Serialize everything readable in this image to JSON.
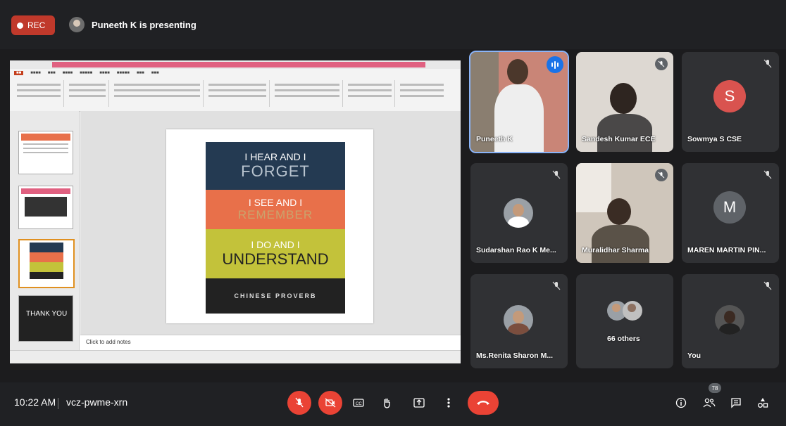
{
  "top_bar": {
    "rec_label": "REC",
    "presenter_text": "Puneeth K is presenting"
  },
  "shared_screen": {
    "slide": {
      "band1_line1": "I HEAR AND I",
      "band1_line2": "FORGET",
      "band2_line1": "I SEE AND I",
      "band2_line2": "REMEMBER",
      "band3_line1": "I DO AND I",
      "band3_line2": "UNDERSTAND",
      "band4_line1": "CHINESE PROVERB"
    },
    "thumbnail_text": "THANK YOU",
    "notes_placeholder": "Click to add notes"
  },
  "participants": [
    {
      "name": "Puneeth K",
      "status": "speaking"
    },
    {
      "name": "Sandesh Kumar ECE",
      "status": "muted"
    },
    {
      "name": "Sowmya S CSE",
      "status": "muted",
      "avatar_letter": "S",
      "avatar_color": "#d9534f"
    },
    {
      "name": "Sudarshan Rao K Me...",
      "status": "muted"
    },
    {
      "name": "Muralidhar Sharma",
      "status": "muted"
    },
    {
      "name": "MAREN MARTIN PIN...",
      "status": "muted",
      "avatar_letter": "M",
      "avatar_color": "#5f6368"
    },
    {
      "name": "Ms.Renita Sharon M...",
      "status": "muted"
    },
    {
      "name": "66 others",
      "status": "group"
    },
    {
      "name": "You",
      "status": "muted"
    }
  ],
  "bottom_bar": {
    "time": "10:22 AM",
    "meeting_code": "vcz-pwme-xrn",
    "participant_count": "78",
    "icons": [
      "mic-off",
      "camera-off",
      "captions",
      "raise-hand",
      "present",
      "more-options",
      "end-call",
      "info",
      "people",
      "chat",
      "activities"
    ]
  }
}
